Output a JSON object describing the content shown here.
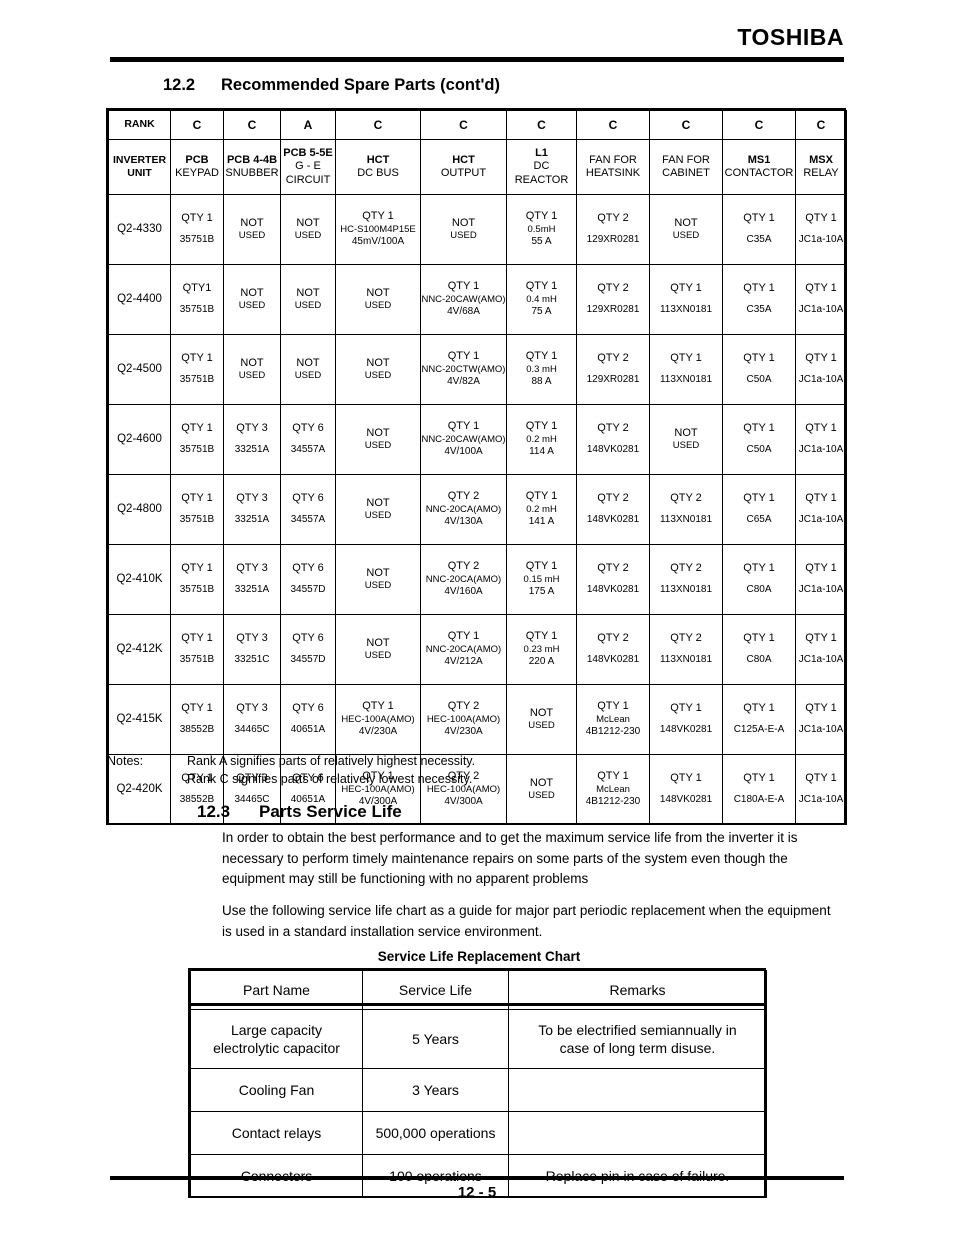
{
  "header": {
    "brand": "TOSHIBA"
  },
  "sections": {
    "spare_parts": {
      "number": "12.2",
      "title": "Recommended Spare Parts (cont'd)"
    },
    "service_life": {
      "number": "12.3",
      "title": "Parts Service Life"
    }
  },
  "parts_table": {
    "rank_row_label": "RANK",
    "ranks": [
      "C",
      "C",
      "A",
      "C",
      "C",
      "C",
      "C",
      "C",
      "C",
      "C"
    ],
    "unit_header": {
      "line1": "INVERTER",
      "line2": "UNIT"
    },
    "columns": [
      {
        "bold": "PCB",
        "normal": "KEYPAD",
        "normal2": ""
      },
      {
        "bold": "PCB 4-4B",
        "normal": "SNUBBER",
        "normal2": ""
      },
      {
        "bold": "PCB 5-5E",
        "normal": "G - E",
        "normal2": "CIRCUIT"
      },
      {
        "bold": "HCT",
        "normal": "DC BUS",
        "normal2": ""
      },
      {
        "bold": "HCT",
        "normal": "OUTPUT",
        "normal2": ""
      },
      {
        "bold": "L1",
        "normal": "DC",
        "normal2": "REACTOR"
      },
      {
        "bold": "",
        "normal": "FAN FOR",
        "normal2": "HEATSINK"
      },
      {
        "bold": "",
        "normal": "FAN FOR",
        "normal2": "CABINET"
      },
      {
        "bold": "MS1",
        "normal": "CONTACTOR",
        "normal2": ""
      },
      {
        "bold": "MSX",
        "normal": "RELAY",
        "normal2": ""
      }
    ],
    "rows": [
      {
        "unit": "Q2-4330",
        "cells": [
          {
            "top": "QTY 1",
            "mid": "",
            "bot": "35751B"
          },
          {
            "top": "NOT",
            "mid": "USED",
            "bot": ""
          },
          {
            "top": "NOT",
            "mid": "USED",
            "bot": ""
          },
          {
            "top": "QTY 1",
            "mid": "HC-S100M4P15E",
            "bot": "45mV/100A"
          },
          {
            "top": "NOT",
            "mid": "USED",
            "bot": ""
          },
          {
            "top": "QTY 1",
            "mid": "0.5mH",
            "bot": "55 A"
          },
          {
            "top": "QTY 2",
            "mid": "",
            "bot": "129XR0281"
          },
          {
            "top": "NOT",
            "mid": "USED",
            "bot": ""
          },
          {
            "top": "QTY 1",
            "mid": "",
            "bot": "C35A"
          },
          {
            "top": "QTY 1",
            "mid": "",
            "bot": "JC1a-10A"
          }
        ]
      },
      {
        "unit": "Q2-4400",
        "cells": [
          {
            "top": "QTY1",
            "mid": "",
            "bot": "35751B"
          },
          {
            "top": "NOT",
            "mid": "USED",
            "bot": ""
          },
          {
            "top": "NOT",
            "mid": "USED",
            "bot": ""
          },
          {
            "top": "NOT",
            "mid": "USED",
            "bot": ""
          },
          {
            "top": "QTY 1",
            "mid": "NNC-20CAW(AMO)",
            "bot": "4V/68A"
          },
          {
            "top": "QTY 1",
            "mid": "0.4 mH",
            "bot": "75 A"
          },
          {
            "top": "QTY 2",
            "mid": "",
            "bot": "129XR0281"
          },
          {
            "top": "QTY 1",
            "mid": "",
            "bot": "113XN0181"
          },
          {
            "top": "QTY 1",
            "mid": "",
            "bot": "C35A"
          },
          {
            "top": "QTY 1",
            "mid": "",
            "bot": "JC1a-10A"
          }
        ]
      },
      {
        "unit": "Q2-4500",
        "cells": [
          {
            "top": "QTY 1",
            "mid": "",
            "bot": "35751B"
          },
          {
            "top": "NOT",
            "mid": "USED",
            "bot": ""
          },
          {
            "top": "NOT",
            "mid": "USED",
            "bot": ""
          },
          {
            "top": "NOT",
            "mid": "USED",
            "bot": ""
          },
          {
            "top": "QTY 1",
            "mid": "NNC-20CTW(AMO)",
            "bot": "4V/82A"
          },
          {
            "top": "QTY 1",
            "mid": "0.3 mH",
            "bot": "88 A"
          },
          {
            "top": "QTY 2",
            "mid": "",
            "bot": "129XR0281"
          },
          {
            "top": "QTY 1",
            "mid": "",
            "bot": "113XN0181"
          },
          {
            "top": "QTY 1",
            "mid": "",
            "bot": "C50A"
          },
          {
            "top": "QTY 1",
            "mid": "",
            "bot": "JC1a-10A"
          }
        ]
      },
      {
        "unit": "Q2-4600",
        "cells": [
          {
            "top": "QTY 1",
            "mid": "",
            "bot": "35751B"
          },
          {
            "top": "QTY 3",
            "mid": "",
            "bot": "33251A"
          },
          {
            "top": "QTY 6",
            "mid": "",
            "bot": "34557A"
          },
          {
            "top": "NOT",
            "mid": "USED",
            "bot": ""
          },
          {
            "top": "QTY 1",
            "mid": "NNC-20CAW(AMO)",
            "bot": "4V/100A"
          },
          {
            "top": "QTY 1",
            "mid": "0.2 mH",
            "bot": "114 A"
          },
          {
            "top": "QTY 2",
            "mid": "",
            "bot": "148VK0281"
          },
          {
            "top": "NOT",
            "mid": "USED",
            "bot": ""
          },
          {
            "top": "QTY 1",
            "mid": "",
            "bot": "C50A"
          },
          {
            "top": "QTY 1",
            "mid": "",
            "bot": "JC1a-10A"
          }
        ]
      },
      {
        "unit": "Q2-4800",
        "cells": [
          {
            "top": "QTY 1",
            "mid": "",
            "bot": "35751B"
          },
          {
            "top": "QTY 3",
            "mid": "",
            "bot": "33251A"
          },
          {
            "top": "QTY 6",
            "mid": "",
            "bot": "34557A"
          },
          {
            "top": "NOT",
            "mid": "USED",
            "bot": ""
          },
          {
            "top": "QTY 2",
            "mid": "NNC-20CA(AMO)",
            "bot": "4V/130A"
          },
          {
            "top": "QTY 1",
            "mid": "0.2 mH",
            "bot": "141 A"
          },
          {
            "top": "QTY 2",
            "mid": "",
            "bot": "148VK0281"
          },
          {
            "top": "QTY 2",
            "mid": "",
            "bot": "113XN0181"
          },
          {
            "top": "QTY 1",
            "mid": "",
            "bot": "C65A"
          },
          {
            "top": "QTY 1",
            "mid": "",
            "bot": "JC1a-10A"
          }
        ]
      },
      {
        "unit": "Q2-410K",
        "cells": [
          {
            "top": "QTY 1",
            "mid": "",
            "bot": "35751B"
          },
          {
            "top": "QTY 3",
            "mid": "",
            "bot": "33251A"
          },
          {
            "top": "QTY 6",
            "mid": "",
            "bot": "34557D"
          },
          {
            "top": "NOT",
            "mid": "USED",
            "bot": ""
          },
          {
            "top": "QTY 2",
            "mid": "NNC-20CA(AMO)",
            "bot": "4V/160A"
          },
          {
            "top": "QTY 1",
            "mid": "0.15 mH",
            "bot": "175 A"
          },
          {
            "top": "QTY 2",
            "mid": "",
            "bot": "148VK0281"
          },
          {
            "top": "QTY 2",
            "mid": "",
            "bot": "113XN0181"
          },
          {
            "top": "QTY 1",
            "mid": "",
            "bot": "C80A"
          },
          {
            "top": "QTY 1",
            "mid": "",
            "bot": "JC1a-10A"
          }
        ]
      },
      {
        "unit": "Q2-412K",
        "cells": [
          {
            "top": "QTY 1",
            "mid": "",
            "bot": "35751B"
          },
          {
            "top": "QTY 3",
            "mid": "",
            "bot": "33251C"
          },
          {
            "top": "QTY 6",
            "mid": "",
            "bot": "34557D"
          },
          {
            "top": "NOT",
            "mid": "USED",
            "bot": ""
          },
          {
            "top": "QTY 1",
            "mid": "NNC-20CA(AMO)",
            "bot": "4V/212A"
          },
          {
            "top": "QTY 1",
            "mid": "0.23 mH",
            "bot": "220 A"
          },
          {
            "top": "QTY 2",
            "mid": "",
            "bot": "148VK0281"
          },
          {
            "top": "QTY 2",
            "mid": "",
            "bot": "113XN0181"
          },
          {
            "top": "QTY 1",
            "mid": "",
            "bot": "C80A"
          },
          {
            "top": "QTY 1",
            "mid": "",
            "bot": "JC1a-10A"
          }
        ]
      },
      {
        "unit": "Q2-415K",
        "cells": [
          {
            "top": "QTY 1",
            "mid": "",
            "bot": "38552B"
          },
          {
            "top": "QTY 3",
            "mid": "",
            "bot": "34465C"
          },
          {
            "top": "QTY 6",
            "mid": "",
            "bot": "40651A"
          },
          {
            "top": "QTY 1",
            "mid": "HEC-100A(AMO)",
            "bot": "4V/230A"
          },
          {
            "top": "QTY 2",
            "mid": "HEC-100A(AMO)",
            "bot": "4V/230A"
          },
          {
            "top": "NOT",
            "mid": "USED",
            "bot": ""
          },
          {
            "top": "QTY 1",
            "mid": "McLean",
            "bot": "4B1212-230"
          },
          {
            "top": "QTY 1",
            "mid": "",
            "bot": "148VK0281"
          },
          {
            "top": "QTY 1",
            "mid": "",
            "bot": "C125A-E-A"
          },
          {
            "top": "QTY 1",
            "mid": "",
            "bot": "JC1a-10A"
          }
        ]
      },
      {
        "unit": "Q2-420K",
        "cells": [
          {
            "top": "QTY 1",
            "mid": "",
            "bot": "38552B"
          },
          {
            "top": "QTY 3",
            "mid": "",
            "bot": "34465C"
          },
          {
            "top": "QTY 6",
            "mid": "",
            "bot": "40651A"
          },
          {
            "top": "QTY 1",
            "mid": "HEC-100A(AMO)",
            "bot": "4V/300A"
          },
          {
            "top": "QTY 2",
            "mid": "HEC-100A(AMO)",
            "bot": "4V/300A"
          },
          {
            "top": "NOT",
            "mid": "USED",
            "bot": ""
          },
          {
            "top": "QTY 1",
            "mid": "McLean",
            "bot": "4B1212-230"
          },
          {
            "top": "QTY 1",
            "mid": "",
            "bot": "148VK0281"
          },
          {
            "top": "QTY 1",
            "mid": "",
            "bot": "C180A-E-A"
          },
          {
            "top": "QTY 1",
            "mid": "",
            "bot": "JC1a-10A"
          }
        ]
      }
    ]
  },
  "notes": {
    "label": "Notes:",
    "line1": "Rank A signifies parts of relatively highest necessity.",
    "line2": "Rank C signifies parts of relatively lowest necessity."
  },
  "service_life_text": {
    "para1": "In order to obtain the best performance and to get the maximum service life from the inverter it is necessary to perform timely maintenance repairs on some parts of the system even though the equipment may still be functioning with no apparent problems",
    "para2": "Use the following service life chart as a guide for major part periodic replacement when the equipment is used in a standard installation service environment."
  },
  "service_life_chart": {
    "title": "Service Life Replacement Chart",
    "headers": [
      "Part Name",
      "Service Life",
      "Remarks"
    ],
    "rows": [
      {
        "part": "Large capacity\nelectrolytic capacitor",
        "life": "5 Years",
        "remarks": "To be electrified semiannually in\ncase of long term disuse."
      },
      {
        "part": "Cooling Fan",
        "life": "3 Years",
        "remarks": ""
      },
      {
        "part": "Contact relays",
        "life": "500,000 operations",
        "remarks": ""
      },
      {
        "part": "Connectors",
        "life": "100 operations",
        "remarks": "Replace pin in case of failure."
      }
    ]
  },
  "footer": {
    "page": "12 - 5"
  }
}
